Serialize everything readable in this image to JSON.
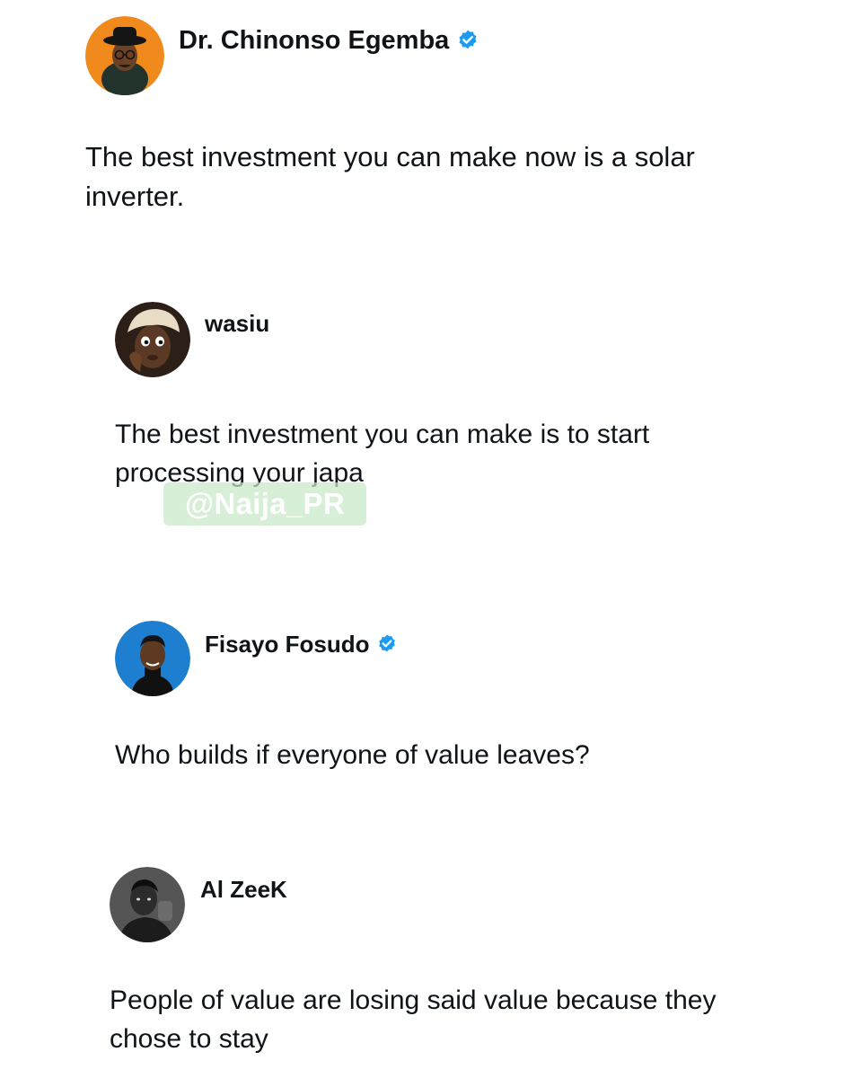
{
  "posts": [
    {
      "author": "Dr. Chinonso Egemba",
      "verified": true,
      "avatar_icon": "avatar-man-hat",
      "text": "The best investment you can make now is a solar inverter."
    },
    {
      "author": "wasiu",
      "verified": false,
      "avatar_icon": "avatar-woman-headwrap",
      "text": "The best investment you can make is to start processing your japa"
    },
    {
      "author": "Fisayo Fosudo",
      "verified": true,
      "avatar_icon": "avatar-man-blue-bg",
      "text": "Who builds if everyone of value leaves?"
    },
    {
      "author": "Al ZeeK",
      "verified": false,
      "avatar_icon": "avatar-man-grayscale",
      "text": "People of value are losing said value because they chose to stay"
    }
  ],
  "watermark": "@Naija_PR",
  "colors": {
    "verified_badge": "#1d9bf0",
    "text": "#0f1419",
    "background": "#ffffff",
    "watermark_bg": "#c8e8c8"
  }
}
